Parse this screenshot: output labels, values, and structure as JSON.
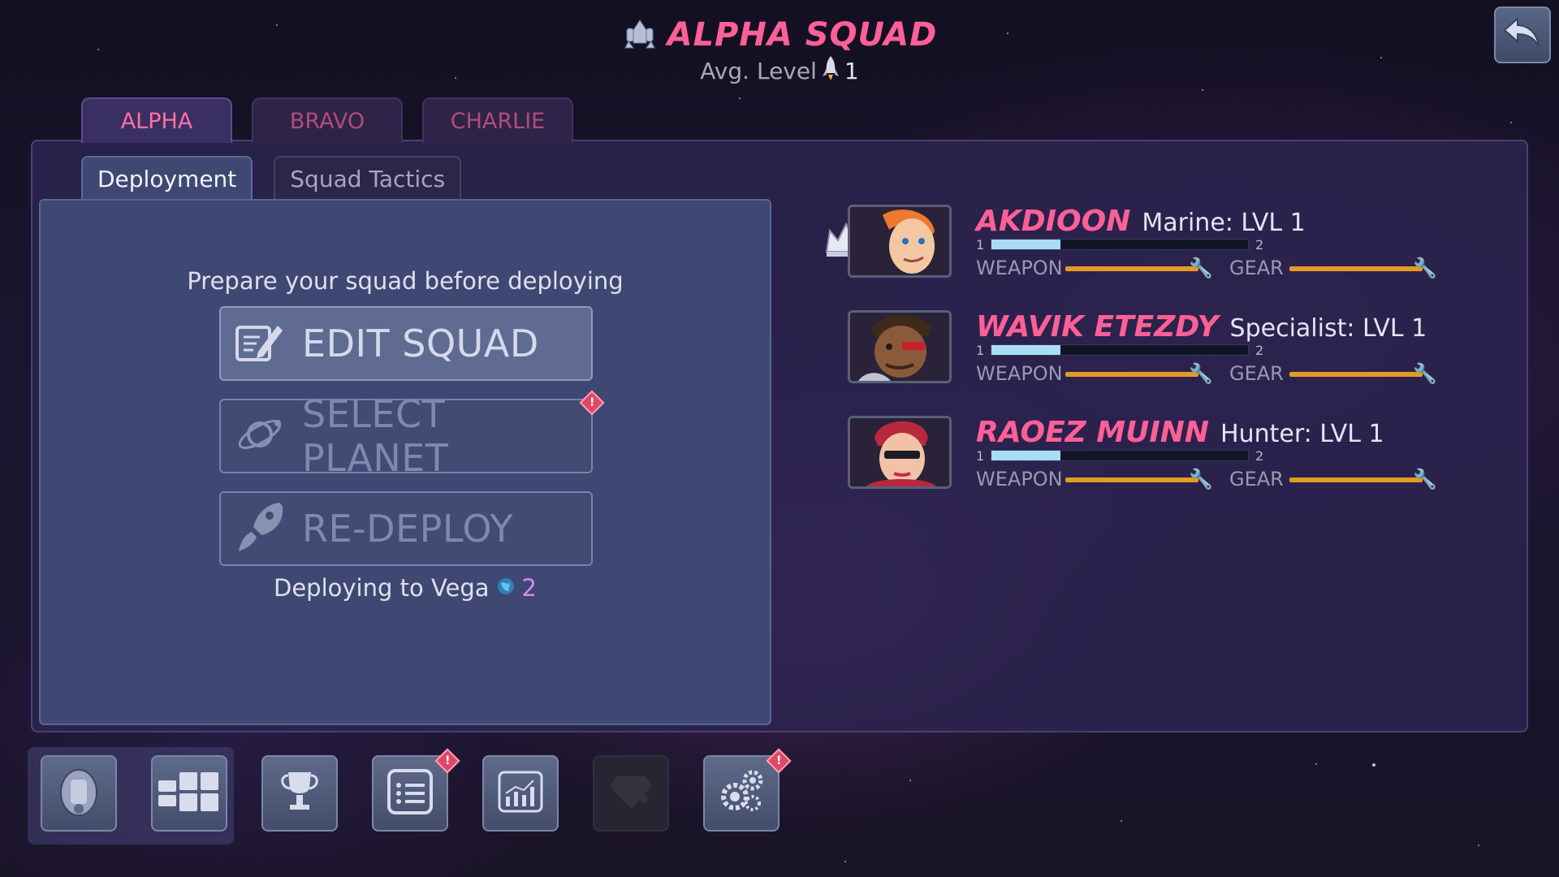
{
  "header": {
    "squad_title": "ALPHA SQUAD",
    "avg_level_label": "Avg. Level",
    "avg_level_value": "1"
  },
  "squad_tabs": [
    {
      "label": "ALPHA",
      "active": true
    },
    {
      "label": "BRAVO",
      "active": false
    },
    {
      "label": "CHARLIE",
      "active": false
    }
  ],
  "inner_tabs": [
    {
      "label": "Deployment",
      "active": true
    },
    {
      "label": "Squad Tactics",
      "active": false
    }
  ],
  "deployment": {
    "prepare_text": "Prepare your squad before deploying",
    "edit_squad_label": "EDIT SQUAD",
    "select_planet_label": "SELECT PLANET",
    "redeploy_label": "RE-DEPLOY",
    "deploying_text": "Deploying to Vega",
    "deploying_count": "2"
  },
  "members": [
    {
      "name": "AKDIOON",
      "class": "Marine: LVL 1",
      "xp_min": "1",
      "xp_max": "2",
      "xp_progress": 0.27,
      "weapon_label": "WEAPON",
      "gear_label": "GEAR",
      "leader": true
    },
    {
      "name": "WAVIK ETEZDY",
      "class": "Specialist: LVL 1",
      "xp_min": "1",
      "xp_max": "2",
      "xp_progress": 0.27,
      "weapon_label": "WEAPON",
      "gear_label": "GEAR",
      "leader": false
    },
    {
      "name": "RAOEZ MUINN",
      "class": "Hunter: LVL 1",
      "xp_min": "1",
      "xp_max": "2",
      "xp_progress": 0.27,
      "weapon_label": "WEAPON",
      "gear_label": "GEAR",
      "leader": false
    }
  ],
  "bottom_nav": [
    {
      "icon": "ship-icon",
      "alert": false,
      "disabled": false
    },
    {
      "icon": "squads-grid-icon",
      "alert": false,
      "disabled": false
    },
    {
      "icon": "trophy-icon",
      "alert": false,
      "disabled": false
    },
    {
      "icon": "missions-list-icon",
      "alert": true,
      "disabled": false
    },
    {
      "icon": "stats-chart-icon",
      "alert": false,
      "disabled": false
    },
    {
      "icon": "premium-gem-icon",
      "alert": false,
      "disabled": true
    },
    {
      "icon": "settings-gears-icon",
      "alert": true,
      "disabled": false
    }
  ],
  "colors": {
    "accent_pink": "#ff5f97",
    "panel_blue": "#3e4872",
    "xp_fill": "#a8dcf7",
    "stat_orange": "#e49a26",
    "alert_red": "#e04767"
  }
}
